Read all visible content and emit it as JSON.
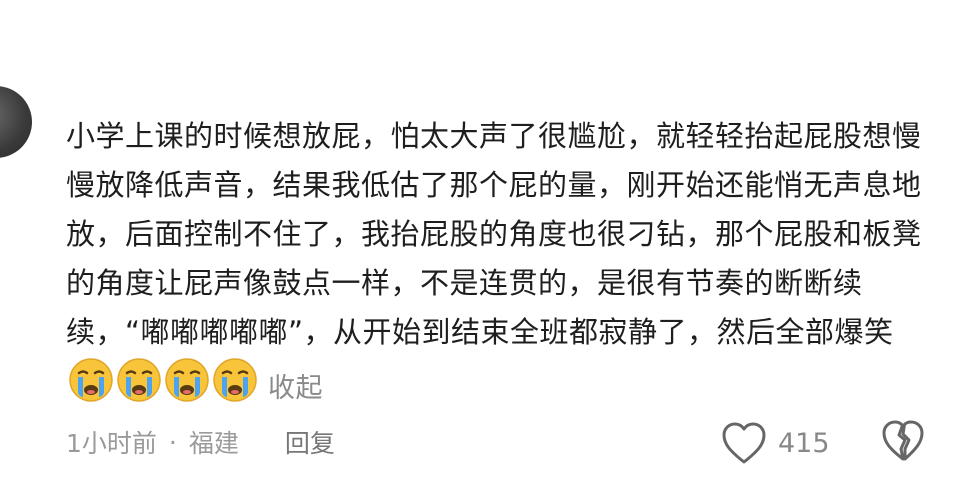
{
  "comment": {
    "text": "小学上课的时候想放屁，怕太大声了很尴尬，就轻轻抬起屁股想慢慢放降低声音，结果我低估了那个屁的量，刚开始还能悄无声息地放，后面控制不住了，我抬屁股的角度也很刁钻，那个屁股和板凳的角度让屁声像鼓点一样，不是连贯的，是很有节奏的断断续续，“嘟嘟嘟嘟嘟”，从开始到结束全班都寂静了，然后全部爆笑",
    "emojis": [
      "crying-face-emoji",
      "crying-face-emoji",
      "crying-face-emoji",
      "crying-face-emoji"
    ],
    "collapse_label": "收起"
  },
  "meta": {
    "time": "1小时前",
    "separator": "·",
    "location": "福建",
    "reply_label": "回复"
  },
  "actions": {
    "like_icon": "heart-outline-icon",
    "like_count": "415",
    "dislike_icon": "broken-heart-icon"
  },
  "colors": {
    "text": "#1e1e1e",
    "muted": "#9a9a9a",
    "emoji_face": "#f7c43a",
    "emoji_tears": "#4ea3f0"
  }
}
